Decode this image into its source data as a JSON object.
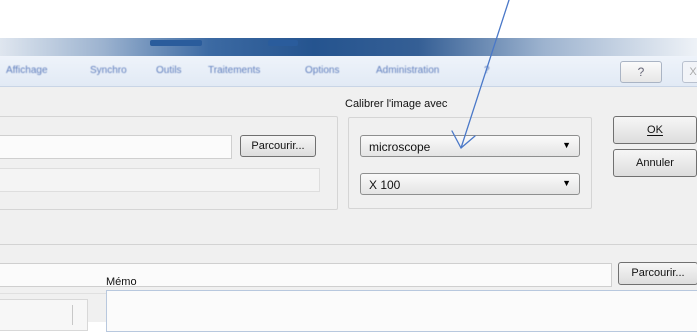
{
  "menu": {
    "items": [
      "Affichage",
      "Synchro",
      "Outils",
      "Traitements",
      "Options",
      "Administration",
      "?"
    ]
  },
  "window": {
    "help_label": "?",
    "close_label": "X"
  },
  "file_section": {
    "browse_label": "Parcourir..."
  },
  "calibrate": {
    "title": "Calibrer l'image avec",
    "device_value": "microscope",
    "magnification_value": "X 100"
  },
  "actions": {
    "ok_label": "OK",
    "cancel_label": "Annuler"
  },
  "path_section": {
    "browse_label": "Parcourir..."
  },
  "memo": {
    "label": "Mémo"
  },
  "colors": {
    "annotation_arrow": "#4a78c8",
    "menu_text": "#5f7ebd"
  }
}
